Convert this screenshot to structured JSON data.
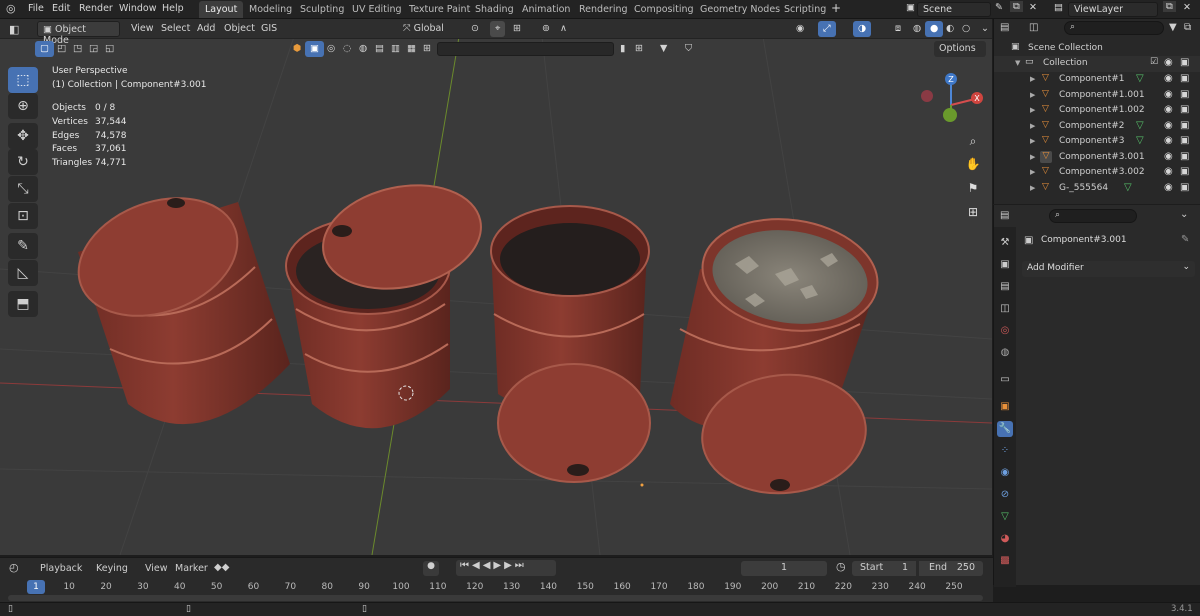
{
  "topbar": {
    "menus": [
      "File",
      "Edit",
      "Render",
      "Window",
      "Help"
    ],
    "workspaces": [
      "Layout",
      "Modeling",
      "Sculpting",
      "UV Editing",
      "Texture Paint",
      "Shading",
      "Animation",
      "Rendering",
      "Compositing",
      "Geometry Nodes",
      "Scripting"
    ],
    "active_workspace": "Layout",
    "add_workspace": "+",
    "scene": "Scene",
    "view_layer": "ViewLayer"
  },
  "viewport_header": {
    "mode": "Object Mode",
    "menus": [
      "View",
      "Select",
      "Add",
      "Object",
      "GIS"
    ],
    "orientation": "Global",
    "options": "Options"
  },
  "viewport": {
    "perspective": "User Perspective",
    "collection_info": "(1) Collection | Component#3.001",
    "stats": [
      {
        "label": "Objects",
        "value": "0 / 8"
      },
      {
        "label": "Vertices",
        "value": "37,544"
      },
      {
        "label": "Edges",
        "value": "74,578"
      },
      {
        "label": "Faces",
        "value": "37,061"
      },
      {
        "label": "Triangles",
        "value": "74,771"
      }
    ],
    "gizmo": {
      "x": "X",
      "z": "Z"
    }
  },
  "outliner": {
    "scene_collection": "Scene Collection",
    "collection": "Collection",
    "items": [
      {
        "name": "Component#1"
      },
      {
        "name": "Component#1.001"
      },
      {
        "name": "Component#1.002"
      },
      {
        "name": "Component#2"
      },
      {
        "name": "Component#3"
      },
      {
        "name": "Component#3.001"
      },
      {
        "name": "Component#3.002"
      },
      {
        "name": "G-_555564"
      }
    ]
  },
  "properties": {
    "object_name": "Component#3.001",
    "add_modifier": "Add Modifier"
  },
  "timeline": {
    "menus": [
      "Playback",
      "Keying",
      "View",
      "Marker"
    ],
    "current_frame": "1",
    "start_label": "Start",
    "start": "1",
    "end_label": "End",
    "end": "250",
    "ticks": [
      "1",
      "10",
      "20",
      "30",
      "40",
      "50",
      "60",
      "70",
      "80",
      "90",
      "100",
      "110",
      "120",
      "130",
      "140",
      "150",
      "160",
      "170",
      "180",
      "190",
      "200",
      "210",
      "220",
      "230",
      "240",
      "250"
    ]
  },
  "statusbar": {
    "version": "3.4.1"
  },
  "colors": {
    "accent": "#4772b3",
    "barrel": "#8a3a2e",
    "viewport": "#3a3a3a",
    "panel": "#282828"
  }
}
